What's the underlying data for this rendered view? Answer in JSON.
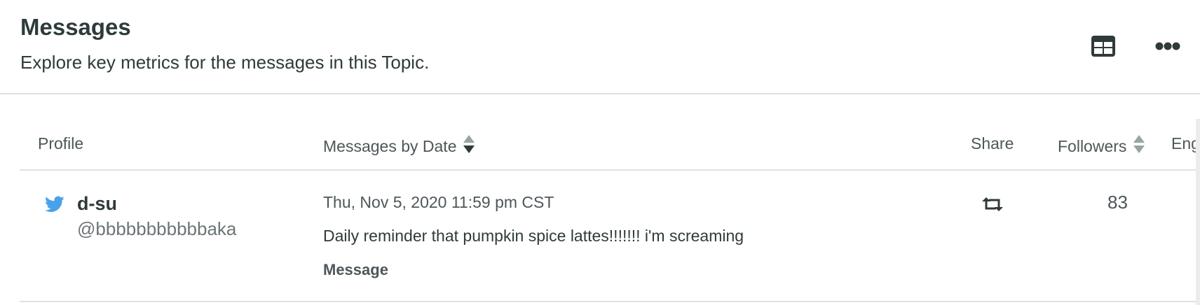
{
  "header": {
    "title": "Messages",
    "subtitle": "Explore key metrics for the messages in this Topic.",
    "actions": [
      {
        "icon": "table-icon"
      },
      {
        "icon": "more-horizontal-icon"
      }
    ]
  },
  "table": {
    "columns": [
      {
        "label": "Profile",
        "sortable": false
      },
      {
        "label": "Messages by Date",
        "sortable": true,
        "sort_state": "descending"
      },
      {
        "label": "Share",
        "sortable": false
      },
      {
        "label": "Followers",
        "sortable": true
      },
      {
        "label": "Eng",
        "sortable": false
      }
    ],
    "rows": [
      {
        "network_icon": "twitter-icon",
        "name": "d-su",
        "handle": "@bbbbbbbbbbbaka",
        "date": "Thu, Nov 5, 2020 11:59 pm CST",
        "text": "Daily reminder that pumpkin spice lattes!!!!!!! i'm screaming",
        "message_link": "Message",
        "share_icon": "retweet-icon",
        "followers": "83"
      }
    ]
  },
  "colors": {
    "text": "#2f3a3b",
    "muted": "#6b7576",
    "twitter": "#4aa1eb",
    "divider": "#dfe2e2"
  }
}
